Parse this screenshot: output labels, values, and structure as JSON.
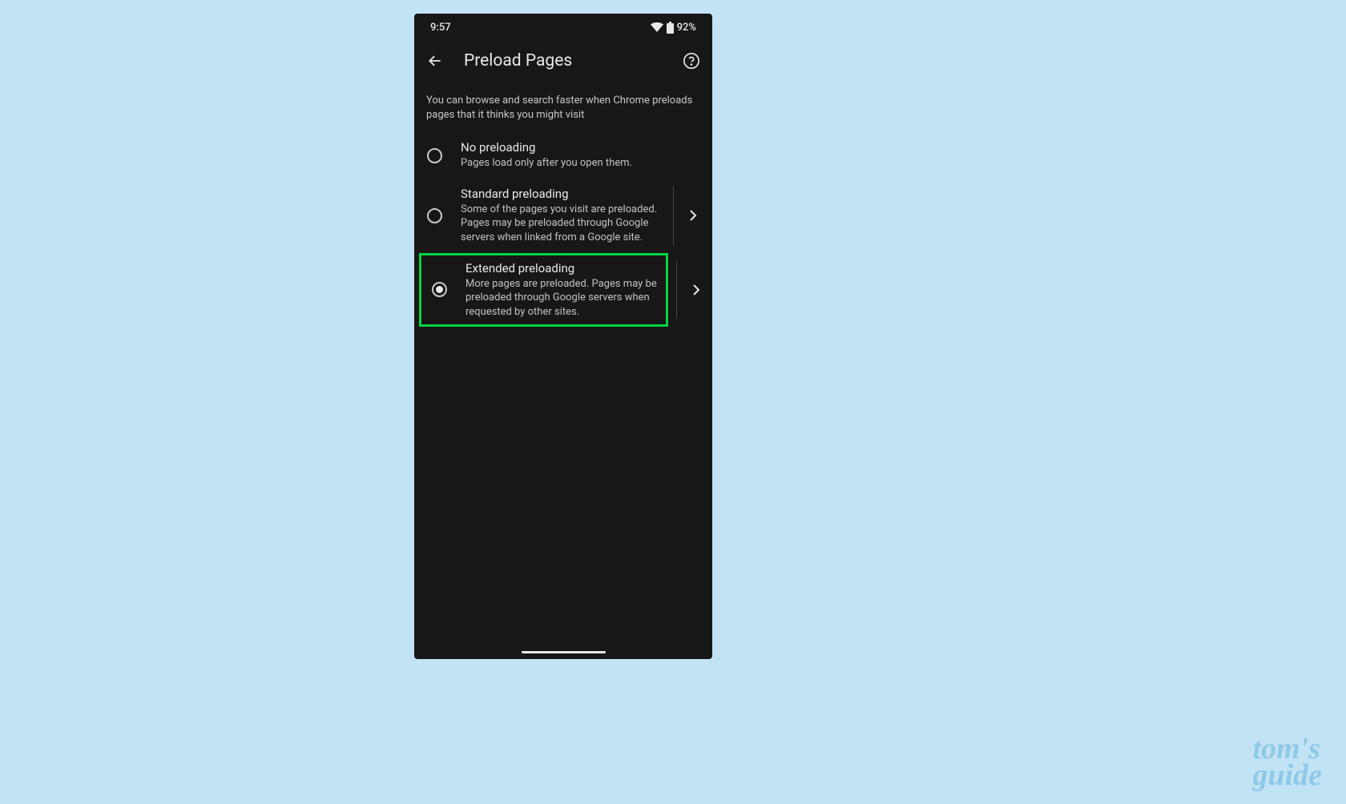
{
  "status_bar": {
    "time": "9:57",
    "battery_percentage": "92%"
  },
  "app_bar": {
    "title": "Preload Pages"
  },
  "description": "You can browse and search faster when Chrome preloads pages that it thinks you might visit",
  "options": [
    {
      "id": "no-preloading",
      "title": "No preloading",
      "description": "Pages load only after you open them.",
      "selected": false,
      "has_chevron": false,
      "highlighted": false
    },
    {
      "id": "standard-preloading",
      "title": "Standard preloading",
      "description": "Some of the pages you visit are preloaded. Pages may be preloaded through Google servers when linked from a Google site.",
      "selected": false,
      "has_chevron": true,
      "highlighted": false
    },
    {
      "id": "extended-preloading",
      "title": "Extended preloading",
      "description": "More pages are preloaded. Pages may be preloaded through Google servers when requested by other sites.",
      "selected": true,
      "has_chevron": true,
      "highlighted": true
    }
  ],
  "watermark": {
    "line1": "tom's",
    "line2": "guide"
  },
  "highlight_color": "#00d442"
}
